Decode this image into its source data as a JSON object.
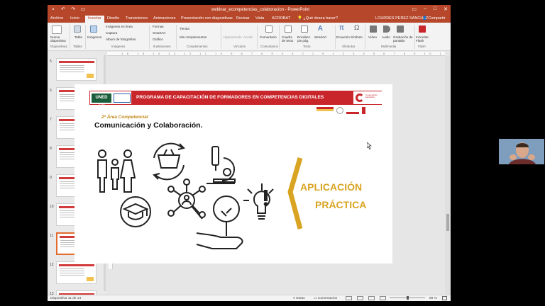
{
  "window": {
    "title": "webinar_ecompetencias_colaboracion - PowerPoint",
    "user": "LOURDES PEREZ SANCHEZ",
    "share": "Compartir",
    "search_placeholder": "¿Qué desea hacer?"
  },
  "tabs": [
    {
      "label": "Archivo",
      "active": false
    },
    {
      "label": "Inicio",
      "active": false
    },
    {
      "label": "Insertar",
      "active": true
    },
    {
      "label": "Diseño",
      "active": false
    },
    {
      "label": "Transiciones",
      "active": false
    },
    {
      "label": "Animaciones",
      "active": false
    },
    {
      "label": "Presentación con diapositivas",
      "active": false
    },
    {
      "label": "Revisar",
      "active": false
    },
    {
      "label": "Vista",
      "active": false
    },
    {
      "label": "ACROBAT",
      "active": false
    }
  ],
  "ribbon": {
    "nueva_diapositiva": "Nueva diapositiva",
    "tabla": "Tabla",
    "imagenes": "Imágenes",
    "imagenes_en_linea": "Imágenes en línea",
    "captura": "Captura",
    "album": "Álbum de fotografías",
    "formas": "Formas",
    "smartart": "SmartArt",
    "grafico": "Gráfico",
    "tienda": "Tienda",
    "mis_complementos": "Mis complementos",
    "hipervinculo": "Hipervínculo",
    "accion": "Acción",
    "comentario": "Comentario",
    "cuadro_texto": "Cuadro de texto",
    "encabezado": "Encabez. pie pág.",
    "wordart": "WordArt",
    "ecuacion": "Ecuación",
    "simbolo": "Símbolo",
    "video": "Vídeo",
    "audio": "Audio",
    "grabacion": "Grabación de pantalla",
    "incrustar_flash": "Incrustar Flash",
    "groups": {
      "diapositivas": "Diapositivas",
      "tablas": "Tablas",
      "imagenes": "Imágenes",
      "ilustraciones": "Ilustraciones",
      "complementos": "Complementos",
      "vinculos": "Vínculos",
      "comentarios": "Comentarios",
      "texto": "Texto",
      "simbolos": "Símbolos",
      "multimedia": "Multimedia",
      "flash": "Flash"
    }
  },
  "ruler_ticks": "16 15 14 13 12 11 10 9 8 7 6 5 4 3 2 1 0 1 2 3 4 5 6 7 8 9 10 11 12 13 14 15 16",
  "thumbnails": [
    {
      "num": "5",
      "selected": false
    },
    {
      "num": "6",
      "selected": false
    },
    {
      "num": "7",
      "selected": false
    },
    {
      "num": "8",
      "selected": false
    },
    {
      "num": "9",
      "selected": false
    },
    {
      "num": "10",
      "selected": false
    },
    {
      "num": "11",
      "selected": true
    },
    {
      "num": "12",
      "selected": false
    },
    {
      "num": "13",
      "selected": false
    }
  ],
  "slide": {
    "banner_logo": "UNED OEI",
    "banner_title": "PROGRAMA DE CAPACITACIÓN DE FORMADORES EN COMPETENCIAS DIGITALES",
    "coop_text": "Cooperación Española",
    "area_subtitle": "2ª Área Competencial",
    "area_title": "Comunicación y Colaboración.",
    "practica_line1": "APLICACIÓN",
    "practica_line2": "PRÁCTICA"
  },
  "status": {
    "slide_counter": "Diapositiva 11 de 14",
    "notes": "Notas",
    "comments": "Comentarios",
    "zoom": "89 %"
  },
  "colors": {
    "accent": "#b7472a",
    "banner_red": "#c9262c",
    "practica_gold": "#d9a421"
  }
}
